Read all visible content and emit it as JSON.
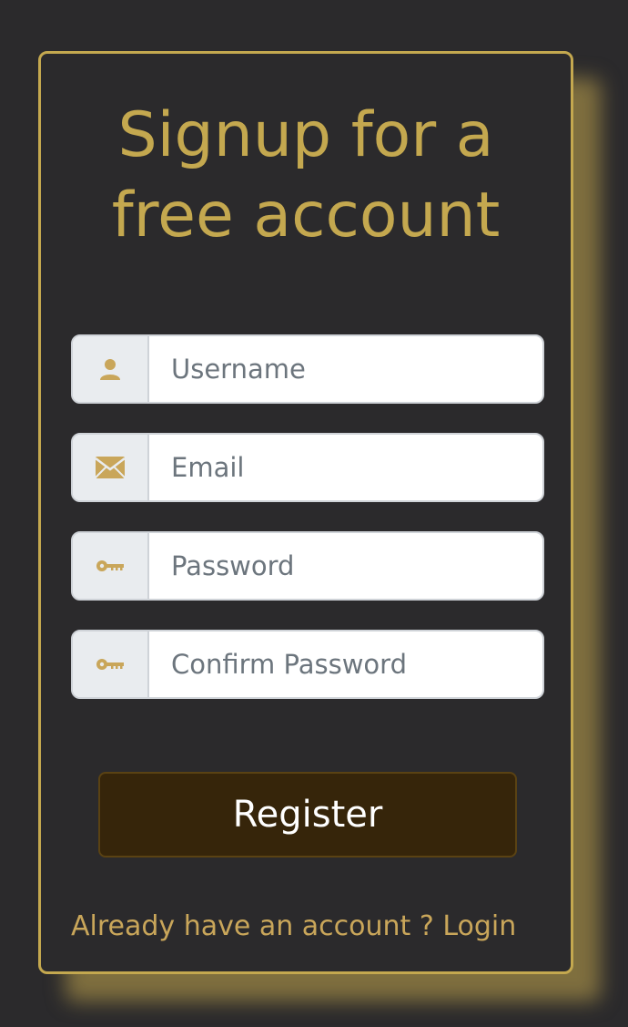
{
  "form": {
    "title_line1": "Signup for a",
    "title_line2": "free account",
    "fields": [
      {
        "icon": "user-icon",
        "placeholder": "Username",
        "value": ""
      },
      {
        "icon": "envelope-icon",
        "placeholder": "Email",
        "value": ""
      },
      {
        "icon": "key-icon",
        "placeholder": "Password",
        "value": ""
      },
      {
        "icon": "key-icon",
        "placeholder": "Confirm Password",
        "value": ""
      }
    ],
    "register_label": "Register",
    "login_prompt": "Already have an account ?",
    "login_link": "Login"
  },
  "colors": {
    "background": "#2b2a2c",
    "accent_gold": "#c4a84f",
    "button_bg": "#36250a",
    "link": "#c9a65a"
  }
}
